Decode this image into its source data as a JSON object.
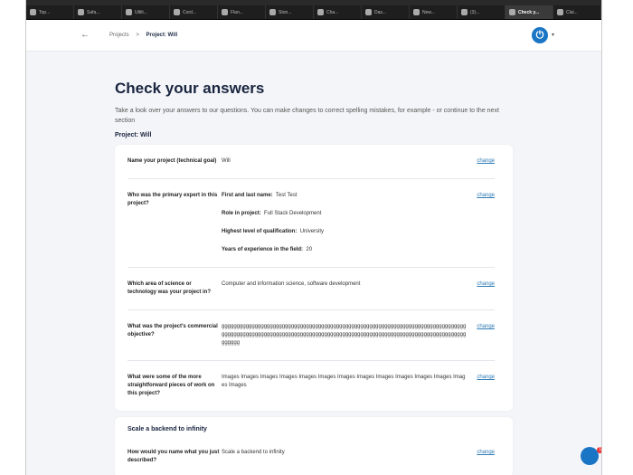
{
  "browser": {
    "tabs": [
      "Top...",
      "Safa...",
      "Utilit...",
      "Cord...",
      "Flan...",
      "Ston...",
      "Cha...",
      "Das...",
      "New...",
      "(3)...",
      "Check y...",
      "Clai..."
    ],
    "active_tab": 10
  },
  "header": {
    "breadcrumb_root": "Projects",
    "breadcrumb_sep": ">",
    "breadcrumb_current": "Project: Will"
  },
  "page": {
    "title": "Check your answers",
    "intro": "Take a look over your answers to our questions. You can make changes to correct spelling mistakes, for example - or continue to the next section",
    "project_label": "Project: Will"
  },
  "change_label": "change",
  "rows": [
    {
      "q": "Name your project (technical goal)",
      "a": "Will"
    },
    {
      "q": "Who was the primary expert in this project?",
      "fields": [
        [
          "First and last name:",
          "Test Test"
        ],
        [
          "Role in project:",
          "Full Stack Development"
        ],
        [
          "Highest level of qualification:",
          "University"
        ],
        [
          "Years of experience in the field:",
          "20"
        ]
      ]
    },
    {
      "q": "Which area of science or technology was your project in?",
      "a": "Computer and information science, software development"
    },
    {
      "q": "What was the project's commercial objective?",
      "a": "gggggggggggggggggggggggggggggggggggggggggggggggggggggggggggggggggggggggggggggggggggggggggggggggggggggggggggggggggggggggggggggggggggggggggggggggggggggggggggggggggggggggg"
    },
    {
      "q": "What were some of the more straightforward pieces of work on this project?",
      "a": "Images Images Images Images Images Images Images Images Images Images Images Images Images Images"
    }
  ],
  "section2": {
    "title": "Scale a backend to infinity",
    "rows": [
      {
        "q": "How would you name what you just described?",
        "a": "Scale a backend to infinity"
      }
    ]
  },
  "chat": {
    "badge": "1"
  }
}
